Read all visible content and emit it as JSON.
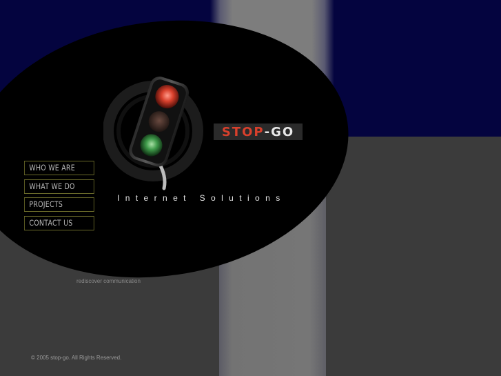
{
  "logo": {
    "stop": "STOP",
    "separator": "-",
    "go": "GO"
  },
  "tagline": "Internet Solutions",
  "nav": {
    "items": [
      {
        "label": "WHO WE ARE"
      },
      {
        "label": "WHAT WE DO"
      },
      {
        "label": "PROJECTS"
      },
      {
        "label": "CONTACT US"
      }
    ]
  },
  "slogan": "rediscover communication",
  "footer": {
    "copyright": "© 2005 stop-go. All Rights Reserved."
  },
  "icons": {
    "traffic_light": "traffic-light-icon"
  },
  "colors": {
    "navy": "#04043f",
    "logo_red": "#d8402c",
    "light_red": "#e0402c",
    "light_green": "#3f9a4a"
  }
}
